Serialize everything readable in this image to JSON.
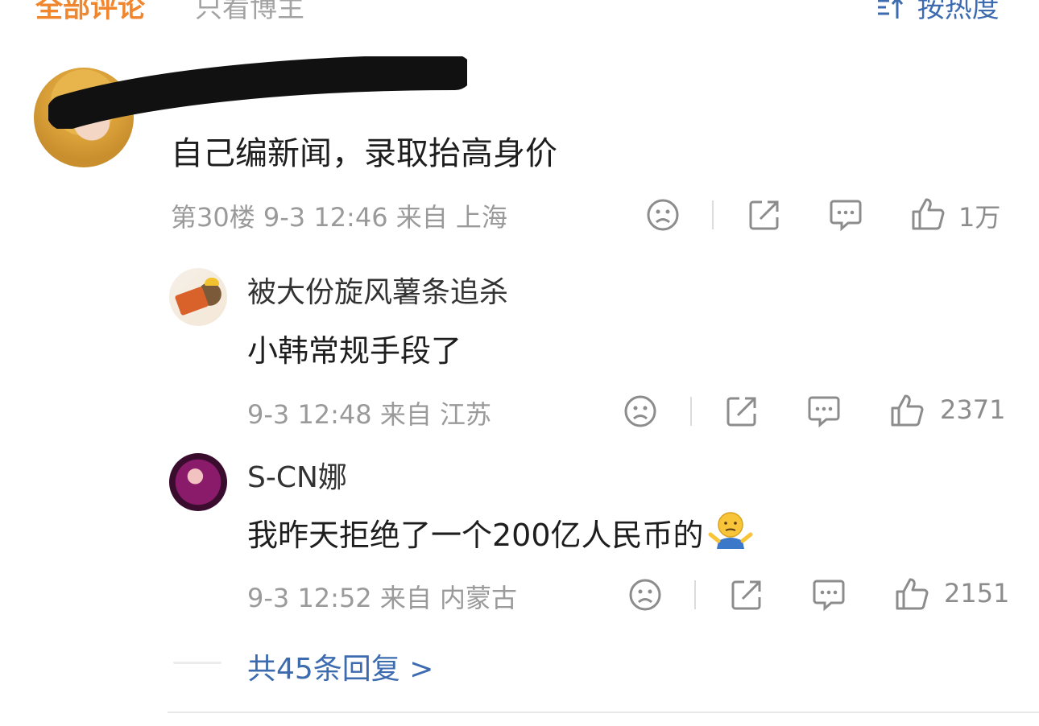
{
  "tabs": {
    "all_comments": "全部评论",
    "owner_only": "只看博主",
    "sort_label": "按热度"
  },
  "main_comment": {
    "text": "自己编新闻，录取抬高身价",
    "floor_time_location": "第30楼 9-3 12:46 来自 上海",
    "like_count": "1万"
  },
  "replies": [
    {
      "username": "被大份旋风薯条追杀",
      "text": "小韩常规手段了",
      "time_location": "9-3 12:48 来自 江苏",
      "like_count": "2371"
    },
    {
      "username": "S-CN娜",
      "text": "我昨天拒绝了一个200亿人民币的",
      "time_location": "9-3 12:52 来自 内蒙古",
      "like_count": "2151"
    }
  ],
  "more_replies": "共45条回复 >",
  "colors": {
    "accent_orange": "#f0872e",
    "link_blue": "#3d6bb0",
    "meta_gray": "#9a9a9a"
  },
  "icons": [
    "sort-icon",
    "dislike-icon",
    "share-icon",
    "comment-icon",
    "like-icon",
    "shrug-emoji-icon"
  ]
}
